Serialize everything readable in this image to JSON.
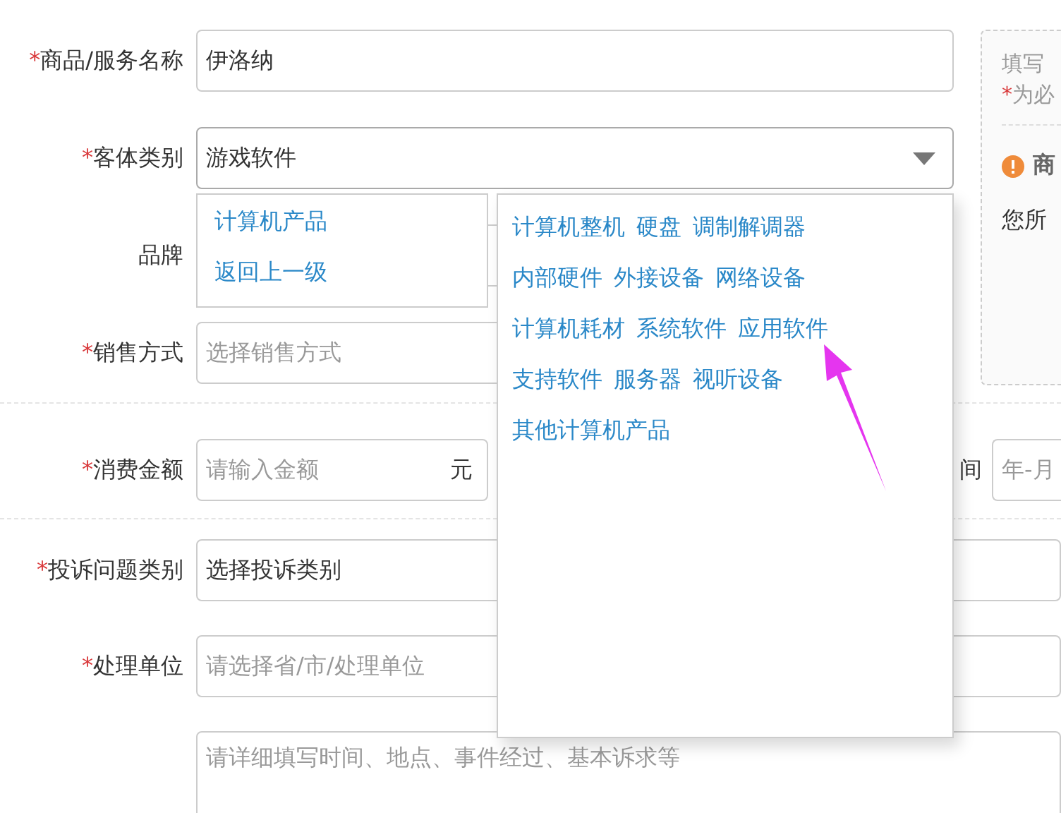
{
  "form": {
    "rows": [
      {
        "kind": "text",
        "label": "商品/服务名称",
        "required": true,
        "value": "伊洛纳"
      },
      {
        "kind": "select",
        "label": "客体类别",
        "required": true,
        "value": "游戏软件",
        "expanded": true
      },
      {
        "kind": "blank",
        "label": "品牌",
        "required": false
      },
      {
        "kind": "placeholder",
        "label": "销售方式",
        "required": true,
        "placeholder": "选择销售方式"
      }
    ]
  },
  "side_panel": {
    "line_1": "填写",
    "line_2_mark": "*",
    "line_2": "为必",
    "notice_title": "商",
    "notice_text": "您所"
  },
  "amount_row": {
    "label": "消费金额",
    "required": true,
    "placeholder": "请输入金额",
    "unit": "元",
    "time_label": "间",
    "time_placeholder": "年-月"
  },
  "lower_rows": [
    {
      "kind": "value",
      "label": "投诉问题类别",
      "required": true,
      "value": "选择投诉类别"
    },
    {
      "kind": "placeholder",
      "label": "处理单位",
      "required": true,
      "placeholder": "请选择省/市/处理单位"
    }
  ],
  "description": {
    "placeholder": "请详细填写时间、地点、事件经过、基本诉求等"
  },
  "category_menu": {
    "levels": [
      "计算机产品",
      "返回上一级"
    ],
    "rows": [
      [
        "计算机整机",
        "硬盘",
        "调制解调器"
      ],
      [
        "内部硬件",
        "外接设备",
        "网络设备"
      ],
      [
        "计算机耗材",
        "系统软件",
        "应用软件"
      ],
      [
        "支持软件",
        "服务器",
        "视听设备"
      ],
      [
        "其他计算机产品"
      ]
    ]
  }
}
